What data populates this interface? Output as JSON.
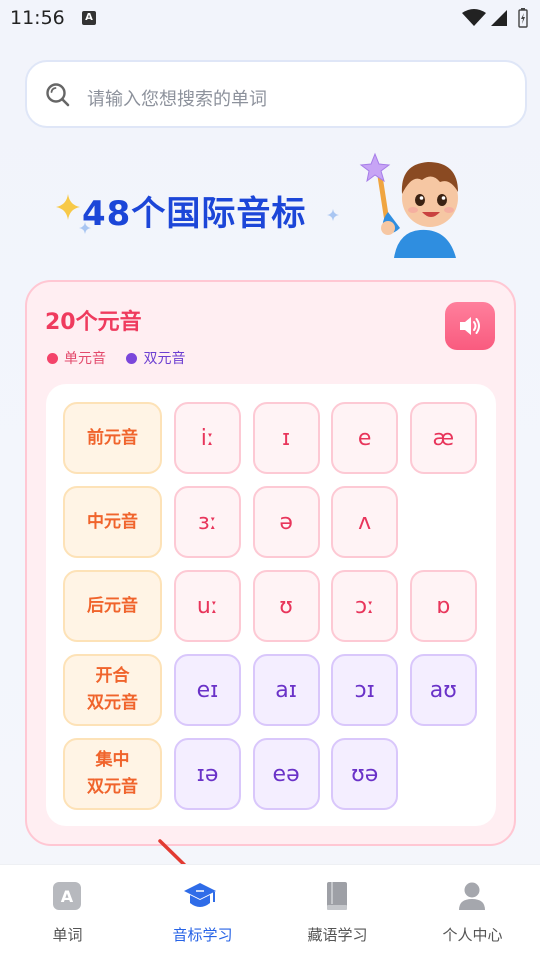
{
  "status_bar": {
    "time": "11:56",
    "notification_badge": "A"
  },
  "search": {
    "placeholder": "请输入您想搜索的单词"
  },
  "banner": {
    "title": "48个国际音标"
  },
  "vowel_card": {
    "title": "20个元音",
    "legend": [
      {
        "label": "单元音",
        "color": "#f4436a"
      },
      {
        "label": "双元音",
        "color": "#7b47db"
      }
    ],
    "rows": [
      {
        "label": [
          "前元音"
        ],
        "symbols": [
          "iː",
          "ɪ",
          "e",
          "æ"
        ],
        "kind": "mono"
      },
      {
        "label": [
          "中元音"
        ],
        "symbols": [
          "ɜː",
          "ə",
          "ʌ"
        ],
        "kind": "mono"
      },
      {
        "label": [
          "后元音"
        ],
        "symbols": [
          "uː",
          "ʊ",
          "ɔː",
          "ɒ"
        ],
        "kind": "mono"
      },
      {
        "label": [
          "开合",
          "双元音"
        ],
        "symbols": [
          "eɪ",
          "aɪ",
          "ɔɪ",
          "aʊ"
        ],
        "kind": "di"
      },
      {
        "label": [
          "集中",
          "双元音"
        ],
        "symbols": [
          "ɪə",
          "eə",
          "ʊə"
        ],
        "kind": "di"
      }
    ]
  },
  "tab_bar": {
    "tabs": [
      {
        "label": "单词",
        "icon": "word-icon",
        "active": false
      },
      {
        "label": "音标学习",
        "icon": "graduation-cap-icon",
        "active": true
      },
      {
        "label": "藏语学习",
        "icon": "book-icon",
        "active": false
      },
      {
        "label": "个人中心",
        "icon": "person-icon",
        "active": false
      }
    ]
  },
  "colors": {
    "accent": "#2763e6",
    "vowel_red": "#ef3b5e",
    "diphthong_purple": "#6a32c8",
    "label_orange": "#f0642c"
  }
}
